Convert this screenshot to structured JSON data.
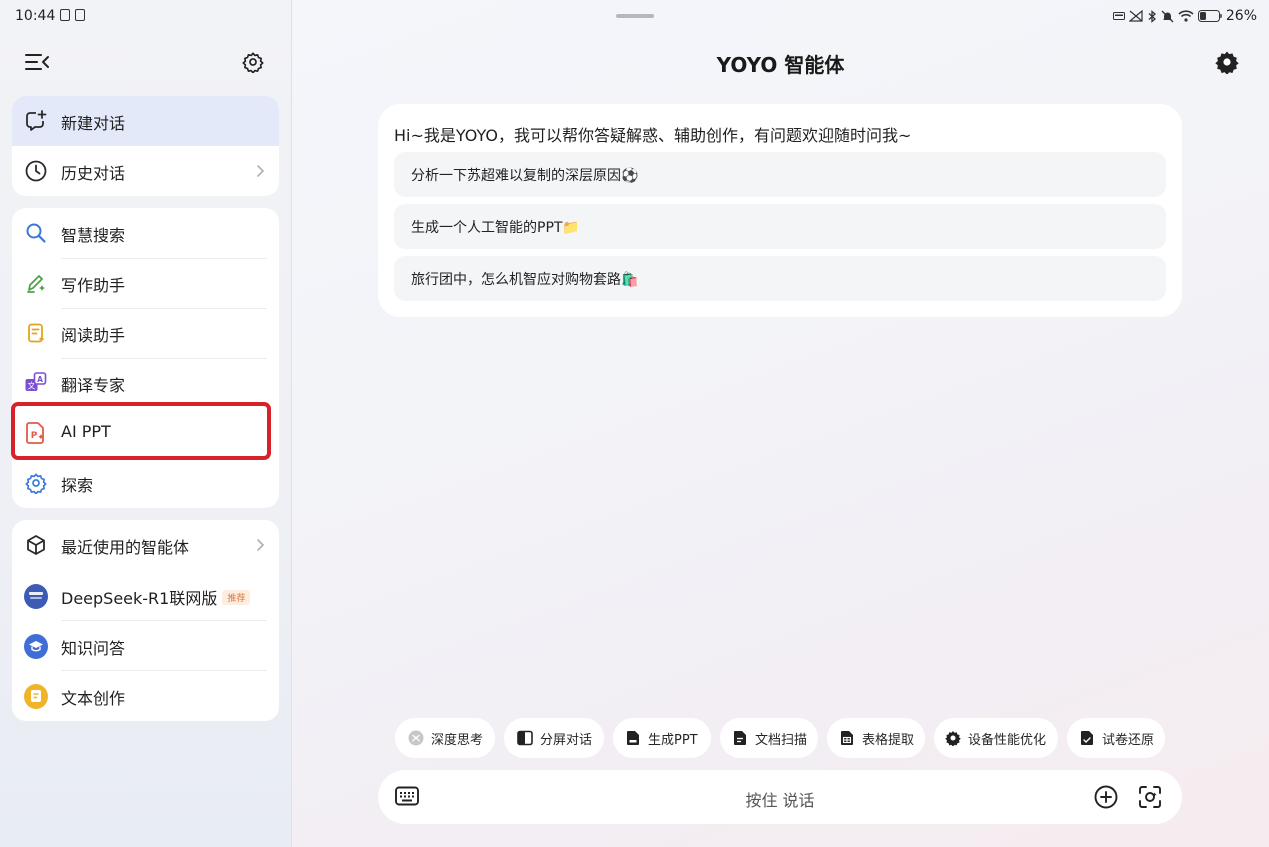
{
  "status_bar": {
    "time": "10:44",
    "battery": "26%"
  },
  "sidebar": {
    "top_group": [
      {
        "label": "新建对话",
        "icon": "new-chat-icon",
        "active": true
      },
      {
        "label": "历史对话",
        "icon": "clock-icon",
        "chevron": true
      }
    ],
    "tools": [
      {
        "label": "智慧搜索",
        "icon": "search-icon"
      },
      {
        "label": "写作助手",
        "icon": "pen-sparkle-icon"
      },
      {
        "label": "阅读助手",
        "icon": "document-sparkle-icon"
      },
      {
        "label": "翻译专家",
        "icon": "translate-icon"
      },
      {
        "label": "AI PPT",
        "icon": "ppt-file-icon"
      },
      {
        "label": "探索",
        "icon": "explore-gear-icon"
      }
    ],
    "agents": {
      "header": "最近使用的智能体",
      "items": [
        {
          "label": "DeepSeek-R1联网版",
          "badge": "推荐",
          "icon": "deepseek-avatar"
        },
        {
          "label": "知识问答",
          "icon": "graduation-cap-avatar"
        },
        {
          "label": "文本创作",
          "icon": "text-creation-avatar"
        }
      ]
    },
    "highlight_color": "#d7222a"
  },
  "main": {
    "title": "YOYO 智能体",
    "welcome": "Hi~我是YOYO，我可以帮你答疑解惑、辅助创作，有问题欢迎随时问我~",
    "suggestions": [
      "分析一下苏超难以复制的深层原因⚽",
      "生成一个人工智能的PPT📁",
      "旅行团中，怎么机智应对购物套路🛍️"
    ],
    "chips": [
      {
        "label": "深度思考",
        "icon": "deep-think-icon"
      },
      {
        "label": "分屏对话",
        "icon": "split-screen-icon"
      },
      {
        "label": "生成PPT",
        "icon": "ppt-icon"
      },
      {
        "label": "文档扫描",
        "icon": "doc-scan-icon"
      },
      {
        "label": "表格提取",
        "icon": "table-extract-icon"
      },
      {
        "label": "设备性能优化",
        "icon": "gear-icon"
      },
      {
        "label": "试卷还原",
        "icon": "exam-restore-icon"
      }
    ],
    "input": {
      "hold_to_talk": "按住 说话"
    }
  }
}
